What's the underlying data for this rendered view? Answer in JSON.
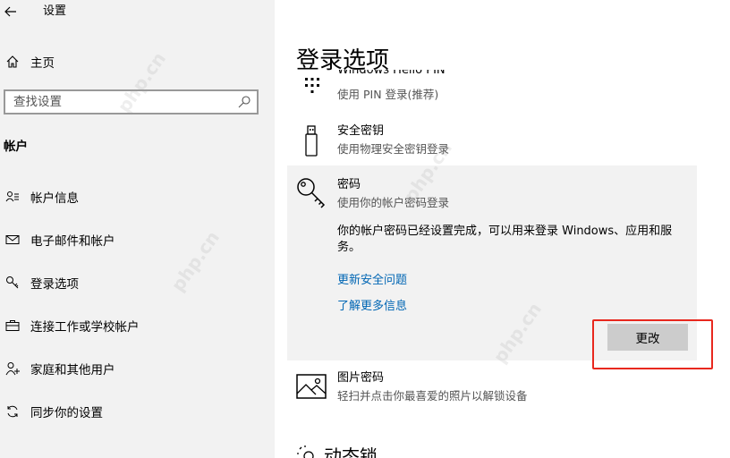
{
  "window": {
    "title": "设置"
  },
  "sidebar": {
    "home_label": "主页",
    "search_placeholder": "查找设置",
    "section_header": "帐户",
    "items": [
      {
        "label": "帐户信息",
        "icon": "person-list-icon"
      },
      {
        "label": "电子邮件和帐户",
        "icon": "mail-icon"
      },
      {
        "label": "登录选项",
        "icon": "key-icon"
      },
      {
        "label": "连接工作或学校帐户",
        "icon": "briefcase-icon"
      },
      {
        "label": "家庭和其他用户",
        "icon": "add-person-icon"
      },
      {
        "label": "同步你的设置",
        "icon": "sync-icon"
      }
    ]
  },
  "main": {
    "title": "登录选项",
    "options": [
      {
        "title": "Windows Hello PIN",
        "subtitle": "使用 PIN 登录(推荐)",
        "icon": "pin-keypad-icon"
      },
      {
        "title": "安全密钥",
        "subtitle": "使用物理安全密钥登录",
        "icon": "usb-key-icon"
      },
      {
        "title": "密码",
        "subtitle": "使用你的帐户密码登录",
        "icon": "key-icon"
      },
      {
        "title": "图片密码",
        "subtitle": "轻扫并点击你最喜爱的照片以解锁设备",
        "icon": "picture-icon"
      },
      {
        "title": "动态锁",
        "icon": "dynamic-lock-icon"
      }
    ],
    "password_detail": {
      "description": "你的帐户密码已经设置完成，可以用来登录 Windows、应用和服务。",
      "link_update_security": "更新安全问题",
      "link_learn_more": "了解更多信息",
      "change_button": "更改"
    }
  },
  "watermark": "php.cn",
  "colors": {
    "accent_link": "#0066b4",
    "highlight_border": "#e8281e",
    "sidebar_bg": "#f2f2f2"
  }
}
